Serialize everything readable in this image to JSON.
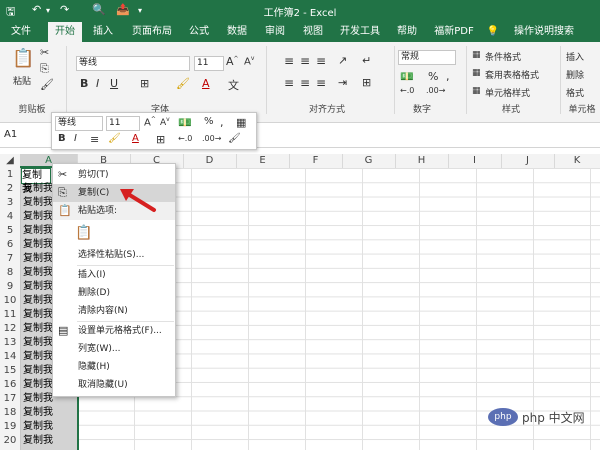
{
  "app": {
    "window_title": "工作簿2 - Excel",
    "tabs": [
      "文件",
      "开始",
      "插入",
      "页面布局",
      "公式",
      "数据",
      "审阅",
      "视图",
      "开发工具",
      "帮助",
      "福新PDF"
    ],
    "active_tab": "开始",
    "tell_me": "操作说明搜索"
  },
  "ribbon": {
    "paste_label": "粘贴",
    "clipboard_group": "剪贴板",
    "font_group": "字体",
    "font_name": "等线",
    "font_size": "11",
    "align_group": "对齐方式",
    "number_group": "数字",
    "number_format": "常规",
    "styles_group": "样式",
    "styles": [
      "条件格式",
      "套用表格格式",
      "单元格样式"
    ],
    "cells_group": "单元格",
    "cells": [
      "插入",
      "删除",
      "格式"
    ]
  },
  "formula_bar": {
    "name_box": "A1"
  },
  "mini_toolbar": {
    "font_name": "等线",
    "font_size": "11",
    "percent": "%",
    "comma": ","
  },
  "columns": [
    "A",
    "B",
    "C",
    "D",
    "E",
    "F",
    "G",
    "H",
    "I",
    "J",
    "K"
  ],
  "rows": [
    "1",
    "2",
    "3",
    "4",
    "5",
    "6",
    "7",
    "8",
    "9",
    "10",
    "11",
    "12",
    "13",
    "14",
    "15",
    "16",
    "17",
    "18",
    "19",
    "20"
  ],
  "cell_text": "复制我",
  "cell_text_truncated": "复制我",
  "context_menu": {
    "cut": "剪切(T)",
    "copy": "复制(C)",
    "paste_options": "粘贴选项:",
    "paste_special": "选择性粘贴(S)...",
    "insert": "插入(I)",
    "delete": "删除(D)",
    "clear": "清除内容(N)",
    "format_cells": "设置单元格格式(F)...",
    "col_width": "列宽(W)...",
    "hide": "隐藏(H)",
    "unhide": "取消隐藏(U)"
  },
  "watermark": {
    "text": "php 中文网"
  }
}
